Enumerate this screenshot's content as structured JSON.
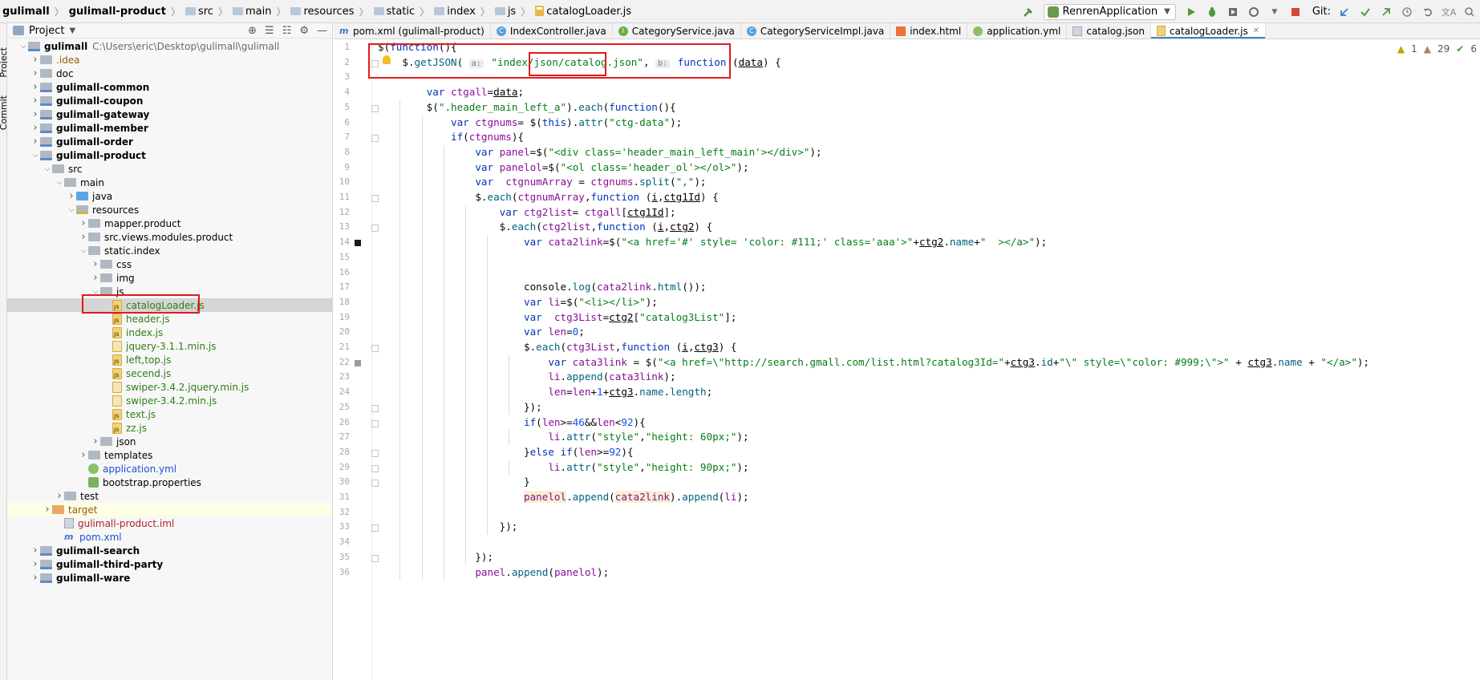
{
  "breadcrumbs": [
    "gulimall",
    "gulimall-product",
    "src",
    "main",
    "resources",
    "static",
    "index",
    "js",
    "catalogLoader.js"
  ],
  "toolbar": {
    "run_config": "RenrenApplication",
    "git_label": "Git:"
  },
  "left_strip": {
    "project_tab": "Project",
    "commit_tab": "Commit"
  },
  "project_panel": {
    "title": "Project",
    "root_path": "C:\\Users\\eric\\Desktop\\gulimall\\gulimall"
  },
  "tree": [
    {
      "label": "gulimall",
      "indent": 0,
      "icon": "module",
      "expanded": true,
      "style": "bold"
    },
    {
      "label": ".idea",
      "indent": 1,
      "icon": "folder",
      "expanded": false,
      "style": "orange"
    },
    {
      "label": "doc",
      "indent": 1,
      "icon": "folder",
      "expanded": false,
      "style": ""
    },
    {
      "label": "gulimall-common",
      "indent": 1,
      "icon": "module",
      "expanded": false,
      "style": "bold"
    },
    {
      "label": "gulimall-coupon",
      "indent": 1,
      "icon": "module",
      "expanded": false,
      "style": "bold"
    },
    {
      "label": "gulimall-gateway",
      "indent": 1,
      "icon": "module",
      "expanded": false,
      "style": "bold"
    },
    {
      "label": "gulimall-member",
      "indent": 1,
      "icon": "module",
      "expanded": false,
      "style": "bold"
    },
    {
      "label": "gulimall-order",
      "indent": 1,
      "icon": "module",
      "expanded": false,
      "style": "bold"
    },
    {
      "label": "gulimall-product",
      "indent": 1,
      "icon": "module",
      "expanded": true,
      "style": "bold"
    },
    {
      "label": "src",
      "indent": 2,
      "icon": "folder",
      "expanded": true,
      "style": ""
    },
    {
      "label": "main",
      "indent": 3,
      "icon": "folder",
      "expanded": true,
      "style": ""
    },
    {
      "label": "java",
      "indent": 4,
      "icon": "srcf",
      "expanded": false,
      "style": ""
    },
    {
      "label": "resources",
      "indent": 4,
      "icon": "resf",
      "expanded": true,
      "style": ""
    },
    {
      "label": "mapper.product",
      "indent": 5,
      "icon": "folder",
      "expanded": false,
      "style": ""
    },
    {
      "label": "src.views.modules.product",
      "indent": 5,
      "icon": "folder",
      "expanded": false,
      "style": ""
    },
    {
      "label": "static.index",
      "indent": 5,
      "icon": "folder",
      "expanded": true,
      "style": ""
    },
    {
      "label": "css",
      "indent": 6,
      "icon": "folder",
      "expanded": false,
      "style": ""
    },
    {
      "label": "img",
      "indent": 6,
      "icon": "folder",
      "expanded": false,
      "style": ""
    },
    {
      "label": "js",
      "indent": 6,
      "icon": "folder",
      "expanded": true,
      "style": ""
    },
    {
      "label": "catalogLoader.js",
      "indent": 7,
      "icon": "js",
      "expanded": null,
      "style": "green",
      "selected": true
    },
    {
      "label": "header.js",
      "indent": 7,
      "icon": "js",
      "expanded": null,
      "style": "green"
    },
    {
      "label": "index.js",
      "indent": 7,
      "icon": "js",
      "expanded": null,
      "style": "green"
    },
    {
      "label": "jquery-3.1.1.min.js",
      "indent": 7,
      "icon": "minjs",
      "expanded": null,
      "style": "green"
    },
    {
      "label": "left,top.js",
      "indent": 7,
      "icon": "js",
      "expanded": null,
      "style": "green"
    },
    {
      "label": "secend.js",
      "indent": 7,
      "icon": "js",
      "expanded": null,
      "style": "green"
    },
    {
      "label": "swiper-3.4.2.jquery.min.js",
      "indent": 7,
      "icon": "minjs",
      "expanded": null,
      "style": "green"
    },
    {
      "label": "swiper-3.4.2.min.js",
      "indent": 7,
      "icon": "minjs",
      "expanded": null,
      "style": "green"
    },
    {
      "label": "text.js",
      "indent": 7,
      "icon": "js",
      "expanded": null,
      "style": "green"
    },
    {
      "label": "zz.js",
      "indent": 7,
      "icon": "js",
      "expanded": null,
      "style": "green"
    },
    {
      "label": "json",
      "indent": 6,
      "icon": "folder",
      "expanded": false,
      "style": ""
    },
    {
      "label": "templates",
      "indent": 5,
      "icon": "folder",
      "expanded": false,
      "style": ""
    },
    {
      "label": "application.yml",
      "indent": 5,
      "icon": "yml",
      "expanded": null,
      "style": "blue"
    },
    {
      "label": "bootstrap.properties",
      "indent": 5,
      "icon": "props",
      "expanded": null,
      "style": ""
    },
    {
      "label": "test",
      "indent": 3,
      "icon": "folder",
      "expanded": false,
      "style": ""
    },
    {
      "label": "target",
      "indent": 2,
      "icon": "excl",
      "expanded": false,
      "style": "orange",
      "target": true
    },
    {
      "label": "gulimall-product.iml",
      "indent": 3,
      "icon": "iml",
      "expanded": null,
      "style": "red"
    },
    {
      "label": "pom.xml",
      "indent": 3,
      "icon": "pom",
      "expanded": null,
      "style": "blue"
    },
    {
      "label": "gulimall-search",
      "indent": 1,
      "icon": "module",
      "expanded": false,
      "style": "bold"
    },
    {
      "label": "gulimall-third-party",
      "indent": 1,
      "icon": "module",
      "expanded": false,
      "style": "bold"
    },
    {
      "label": "gulimall-ware",
      "indent": 1,
      "icon": "module",
      "expanded": false,
      "style": "bold"
    }
  ],
  "tabs": [
    {
      "label": "pom.xml (gulimall-product)",
      "icon": "m"
    },
    {
      "label": "IndexController.java",
      "icon": "c"
    },
    {
      "label": "CategoryService.java",
      "icon": "i"
    },
    {
      "label": "CategoryServiceImpl.java",
      "icon": "c"
    },
    {
      "label": "index.html",
      "icon": "h"
    },
    {
      "label": "application.yml",
      "icon": "y"
    },
    {
      "label": "catalog.json",
      "icon": "j"
    },
    {
      "label": "catalogLoader.js",
      "icon": "js",
      "active": true
    }
  ],
  "inspections": {
    "warnings": "1",
    "weak_warnings": "29",
    "typos": "6"
  },
  "code_lines": [
    "$(function(){",
    "    $.getJSON( a: \"index/json/catalog.json\", b: function (data) {",
    "",
    "        var ctgall=data;",
    "        $(\".header_main_left_a\").each(function(){",
    "            var ctgnums= $(this).attr(\"ctg-data\");",
    "            if(ctgnums){",
    "                var panel=$(\"<div class='header_main_left_main'></div>\");",
    "                var panelol=$(\"<ol class='header_ol'></ol>\");",
    "                var  ctgnumArray = ctgnums.split(\",\");",
    "                $.each(ctgnumArray,function (i,ctg1Id) {",
    "                    var ctg2list= ctgall[ctg1Id];",
    "                    $.each(ctg2list,function (i,ctg2) {",
    "                        var cata2link=$(\"<a href='#' style= 'color: #111;' class='aaa'>\"+ctg2.name+\"  ></a>\");",
    "",
    "",
    "                        console.log(cata2link.html());",
    "                        var li=$(\"<li></li>\");",
    "                        var  ctg3List=ctg2[\"catalog3List\"];",
    "                        var len=0;",
    "                        $.each(ctg3List,function (i,ctg3) {",
    "                            var cata3link = $(\"<a href=\\\"http://search.gmall.com/list.html?catalog3Id=\"+ctg3.id+\"\\\" style=\\\"color: #999;\\\">\" + ctg3.name + \"</a>\");",
    "                            li.append(cata3link);",
    "                            len=len+1+ctg3.name.length;",
    "                        });",
    "                        if(len>=46&&len<92){",
    "                            li.attr(\"style\",\"height: 60px;\");",
    "                        }else if(len>=92){",
    "                            li.attr(\"style\",\"height: 90px;\");",
    "                        }",
    "                        panelol.append(cata2link).append(li);",
    "",
    "                    });",
    "",
    "                });",
    "                panel.append(panelol);"
  ]
}
